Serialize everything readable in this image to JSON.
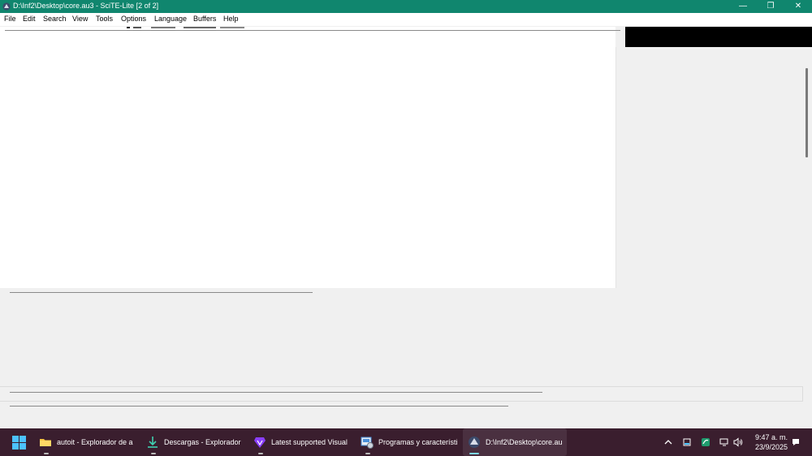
{
  "window": {
    "title": "D:\\Inf2\\Desktop\\core.au3 - SciTE-Lite [2 of 2]",
    "controls": {
      "minimize": "—",
      "restore": "❐",
      "close": "✕"
    }
  },
  "menu": [
    "File",
    "Edit",
    "Search",
    "View",
    "Tools",
    "Options",
    "Language",
    "Buffers",
    "Help"
  ],
  "taskbar": {
    "apps": [
      {
        "label": "autoit - Explorador de a",
        "icon": "folder-icon"
      },
      {
        "label": "Descargas - Explorador",
        "icon": "download-icon"
      },
      {
        "label": "Latest supported Visual",
        "icon": "brave-browser-icon"
      },
      {
        "label": "Programas y característi",
        "icon": "control-panel-icon"
      },
      {
        "label": "D:\\Inf2\\Desktop\\core.au",
        "icon": "scite-icon"
      }
    ],
    "clock": {
      "time": "9:47 a. m.",
      "date": "23/9/2025"
    }
  },
  "colors": {
    "titlebar": "#10866e",
    "taskbar": "#3a1e2e",
    "accent": "#7fd8e8"
  }
}
